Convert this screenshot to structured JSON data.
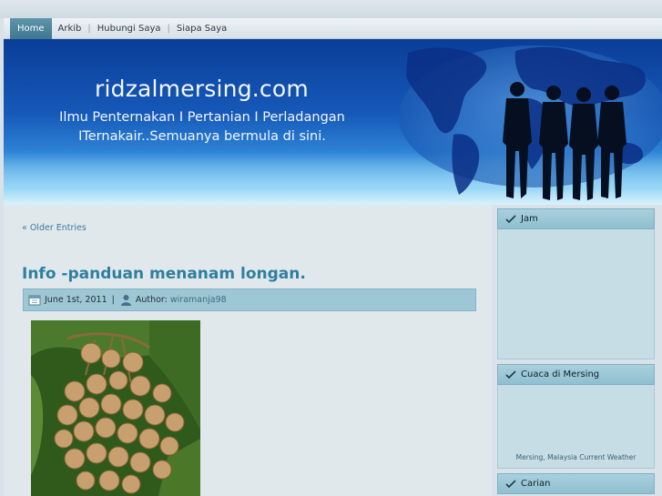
{
  "nav": {
    "items": [
      {
        "label": "Home",
        "active": true
      },
      {
        "label": "Arkib"
      },
      {
        "label": "Hubungi Saya"
      },
      {
        "label": "Siapa Saya"
      }
    ],
    "separator": "|"
  },
  "header": {
    "title": "ridzalmersing.com",
    "tagline_line1": "Ilmu Penternakan I Pertanian I Perladangan",
    "tagline_line2": "ITernakair..Semuanya bermula di sini."
  },
  "content": {
    "older_entries": "« Older Entries",
    "post": {
      "title": "Info -panduan menanam longan.",
      "date": "June 1st, 2011",
      "meta_separator": "|",
      "author_label": "Author:",
      "author": "wiramanja98"
    }
  },
  "sidebar": {
    "widgets": [
      {
        "title": "Jam"
      },
      {
        "title": "Cuaca di Mersing",
        "body_text": "Mersing, Malaysia Current Weather"
      },
      {
        "title": "Carian"
      }
    ]
  },
  "colors": {
    "accent": "#3d7790",
    "link": "#2e7fa0",
    "header_blue": "#1659b8",
    "widget_head": "#9ec7d6"
  }
}
